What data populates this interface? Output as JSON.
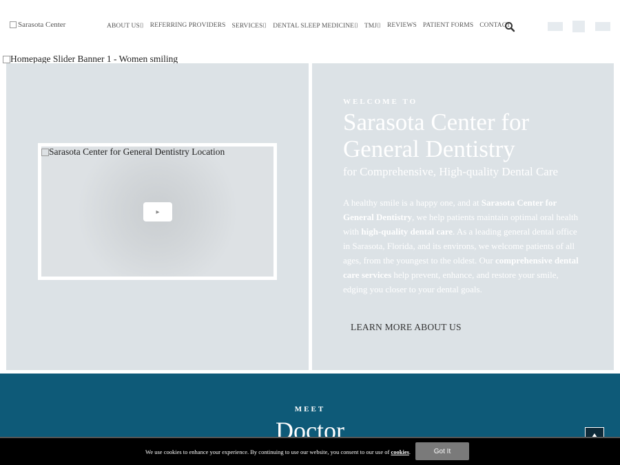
{
  "header": {
    "logo_alt": "Sarasota Center",
    "nav": [
      {
        "label": "ABOUT US",
        "caret": "⌷"
      },
      {
        "label": "REFERRING PROVIDERS",
        "caret": ""
      },
      {
        "label": "SERVICES",
        "caret": "⌷"
      },
      {
        "label": "DENTAL SLEEP MEDICINE",
        "caret": "⌷"
      },
      {
        "label": "TMJ",
        "caret": "⌷"
      },
      {
        "label": "REVIEWS",
        "caret": ""
      },
      {
        "label": "PATIENT FORMS",
        "caret": ""
      },
      {
        "label": "CONTACT",
        "caret": ""
      }
    ]
  },
  "slider": {
    "alt": "Homepage Slider Banner 1 - Women smiling"
  },
  "video": {
    "alt": "Sarasota Center for General Dentistry Location",
    "play_glyph": "▸"
  },
  "hero": {
    "welcome": "WELCOME TO",
    "title": "Sarasota Center for General Dentistry",
    "subtitle": "for Comprehensive, High-quality Dental Care",
    "body_1": "A healthy smile is a happy one, and at ",
    "body_b1": "Sarasota Center for General Dentistry",
    "body_2": ", we help patients maintain optimal oral health with ",
    "body_b2": "high-quality dental care",
    "body_3": ". As a leading general dental office in Sarasota, Florida, and its environs, we welcome patients of all ages, from the youngest to the oldest. Our ",
    "body_b3": "comprehensive dental care services",
    "body_4": " help prevent, enhance, and restore your smile, edging you closer to your dental goals.",
    "cta": "LEARN MORE ABOUT US"
  },
  "band": {
    "meet": "MEET",
    "doctor": "Doctor"
  },
  "cookie": {
    "text_before": "We use cookies to enhance your experience. By continuing to use our website, you consent to our use of ",
    "link": "cookies",
    "text_after": ".",
    "button": "Got It"
  },
  "colors": {
    "band": "#0e5a78",
    "panel": "#dce2e6",
    "cookie_bg": "#000000",
    "button": "#7a7a7a"
  },
  "icons": [
    "search-icon",
    "play-icon",
    "arrow-up-icon"
  ]
}
